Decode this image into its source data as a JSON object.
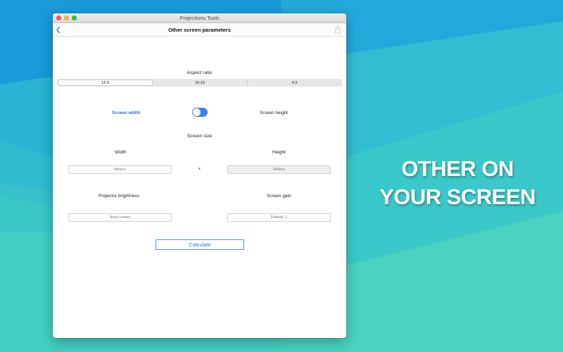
{
  "window": {
    "title": "Projections Tools"
  },
  "navbar": {
    "title": "Other screen parameters",
    "back_icon": "chevron-left-icon",
    "share_icon": "share-icon"
  },
  "aspect_ratio": {
    "title": "Aspect ratio",
    "options": [
      "16:9",
      "16:10",
      "4:3"
    ],
    "selected": "16:9"
  },
  "mode": {
    "left_label": "Screen width",
    "right_label": "Screen height",
    "toggle_on": true
  },
  "screen_size": {
    "title": "Screen size",
    "width_label": "Width",
    "height_label": "Height",
    "width_placeholder": "Meters",
    "height_placeholder": "Meters",
    "separator": "x"
  },
  "brightness": {
    "label": "Projector brightness",
    "placeholder": "Ansi Lumen"
  },
  "gain": {
    "label": "Screen gain",
    "placeholder": "Default: 1"
  },
  "calculate_label": "Calculate",
  "promo": {
    "line1": "OTHER ON",
    "line2": "YOUR SCREEN"
  },
  "colors": {
    "accent": "#3b82f0",
    "background": "#3cc4c8"
  }
}
